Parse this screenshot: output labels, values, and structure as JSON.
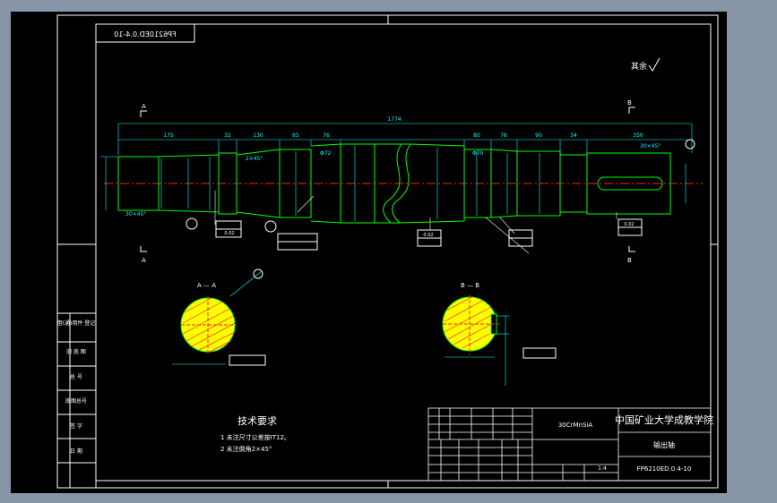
{
  "title_block": {
    "school": "中国矿业大学成教学院",
    "part_name": "输出轴",
    "drawing_no": "FP6210ED.0.4-10",
    "mirrored_code": "FP6210ED.0.4-10",
    "scale": "1:4",
    "material": "30CrMnSiA"
  },
  "left_strip": [
    {
      "label": "借(通)用件 登记"
    },
    {
      "label": "旧 底 图"
    },
    {
      "label": "总 号"
    },
    {
      "label": "底图总号"
    },
    {
      "label": "签 字"
    },
    {
      "label": "日 期"
    }
  ],
  "tech_requirements": {
    "heading": "技术要求",
    "lines": [
      "1 未注尺寸公差按IT12。",
      "2 未注倒角2×45°"
    ]
  },
  "sections": {
    "a_label": "A — A",
    "b_label": "B — B",
    "cut_a": "A",
    "cut_b": "B"
  },
  "roughness_note": "其余",
  "dimensions": {
    "overall": "1774",
    "segments": [
      "175",
      "32",
      "130",
      "65",
      "76",
      "80",
      "76",
      "90",
      "34",
      "350"
    ],
    "chamfers": [
      "30×45°",
      "2×45°",
      "30×45°"
    ],
    "diameters": [
      "Φ72",
      "Φ70"
    ]
  },
  "tolerances": {
    "tol1": "0.02",
    "tol2": "0.02",
    "tol3": "0.02"
  },
  "colors": {
    "frame": "#ffffff",
    "shaft": "#00ff00",
    "dim": "#00ffff",
    "center": "#ff2020",
    "hatch": "#ff2020",
    "section_fill": "#ffff00"
  }
}
